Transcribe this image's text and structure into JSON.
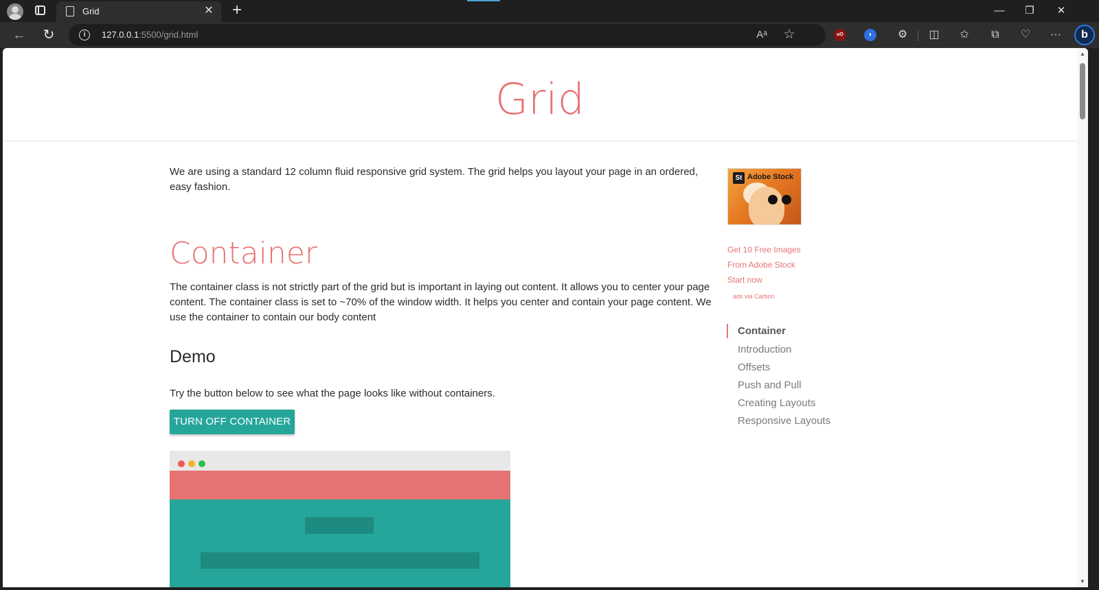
{
  "browser": {
    "tab_title": "Grid",
    "tab_close": "✕",
    "new_tab": "+",
    "url_host": "127.0.0.1",
    "url_path": ":5500/grid.html",
    "read_aloud": "Aᵃ",
    "favorite": "☆",
    "ublock_label": "uO",
    "extensions": "⧉",
    "more": "···",
    "bing": "b",
    "window_minimize": "—",
    "window_restore": "❐",
    "window_close": "✕"
  },
  "page": {
    "title": "Grid",
    "intro": "We are using a standard 12 column fluid responsive grid system. The grid helps you layout your page in an ordered, easy fashion.",
    "section_title": "Container",
    "section_text": "The container class is not strictly part of the grid but is important in laying out content. It allows you to center your page content. The container class is set to ~70% of the window width. It helps you center and contain your page content. We use the container to contain our body content",
    "demo_title": "Demo",
    "demo_text": "Try the button below to see what the page looks like without containers.",
    "button_label": "TURN OFF CONTAINER"
  },
  "ad": {
    "badge": "St",
    "brand": "Adobe Stock",
    "line1": "Get 10 Free Images",
    "line2": "From Adobe Stock",
    "line3": "Start now",
    "via": "ads via Carbon"
  },
  "toc": {
    "items": [
      {
        "label": "Container"
      },
      {
        "label": "Introduction"
      },
      {
        "label": "Offsets"
      },
      {
        "label": "Push and Pull"
      },
      {
        "label": "Creating Layouts"
      },
      {
        "label": "Responsive Layouts"
      }
    ]
  },
  "colors": {
    "accent": "#e57373",
    "teal": "#26a69a",
    "dot_red": "#ee5a52",
    "dot_yellow": "#f4b32d",
    "dot_green": "#29c24a"
  }
}
